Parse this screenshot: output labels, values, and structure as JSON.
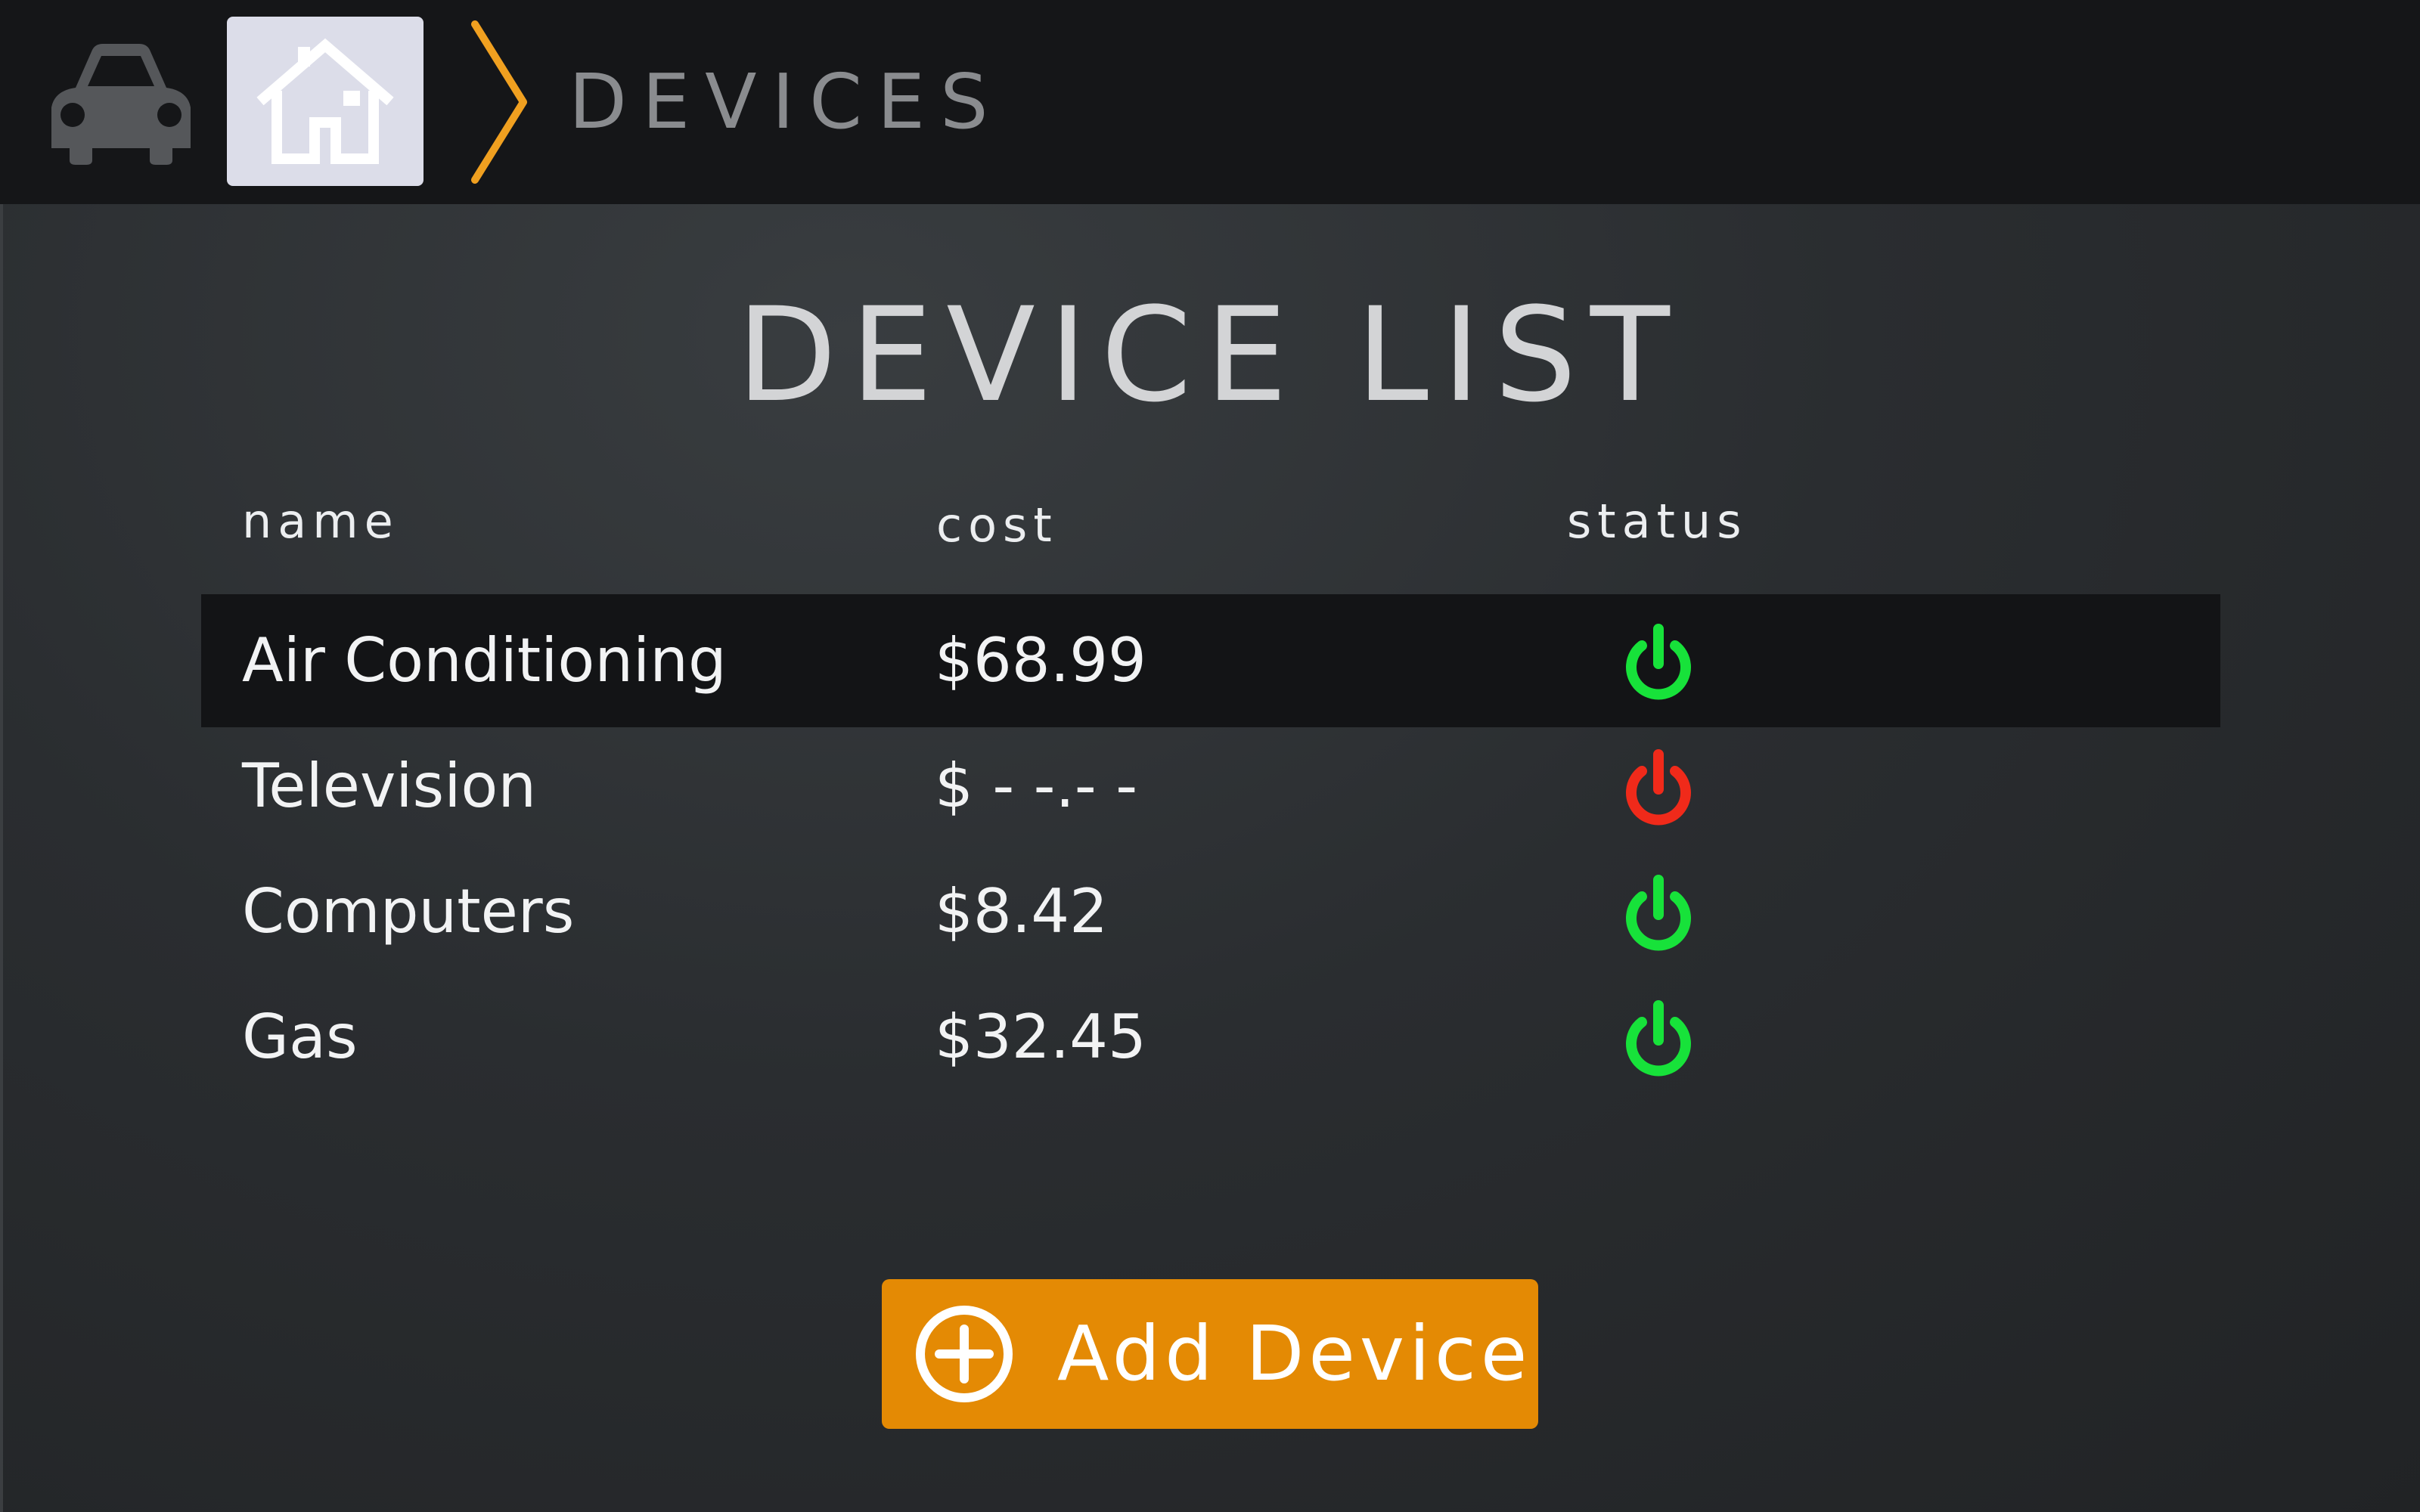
{
  "header": {
    "breadcrumb_label": "DEVICES",
    "icons": {
      "car": "car-icon",
      "home": "home-icon",
      "chevron": "chevron-right-icon"
    }
  },
  "main": {
    "title": "DEVICE LIST",
    "columns": {
      "name": "name",
      "cost": "cost",
      "status": "status"
    },
    "devices": [
      {
        "name": "Air Conditioning",
        "cost": "$68.99",
        "status": "on",
        "selected": true
      },
      {
        "name": "Television",
        "cost": "$ - -.- -",
        "status": "off",
        "selected": false
      },
      {
        "name": "Computers",
        "cost": "$8.42",
        "status": "on",
        "selected": false
      },
      {
        "name": "Gas",
        "cost": "$32.45",
        "status": "on",
        "selected": false
      }
    ],
    "add_button_label": "Add Device"
  },
  "colors": {
    "accent": "#e48a04",
    "chevron": "#f0a020",
    "status_on": "#17e23a",
    "status_off": "#f02a1a",
    "selected_row": "#131416"
  }
}
